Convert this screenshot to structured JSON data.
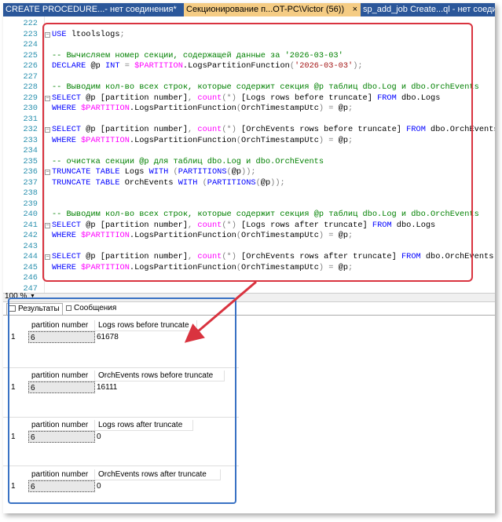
{
  "tabs": [
    {
      "label": "CREATE PROCEDURE...- нет соединения*",
      "active": false
    },
    {
      "label": "Секционирование п...OT-PC\\Victor (56))",
      "active": true
    },
    {
      "label": "sp_add_job Create...ql - нет соединения",
      "active": false
    }
  ],
  "close_glyph": "×",
  "lines": [
    {
      "n": "222",
      "t": ""
    },
    {
      "n": "223",
      "t": "USE ltoolslogs;"
    },
    {
      "n": "224",
      "t": ""
    },
    {
      "n": "225",
      "t": "-- Вычисляем номер секции, содержащей данные за '2026-03-03'"
    },
    {
      "n": "226",
      "t": "DECLARE @p INT = $PARTITION.LogsPartitionFunction('2026-03-03');"
    },
    {
      "n": "227",
      "t": ""
    },
    {
      "n": "228",
      "t": "-- Выводим кол-во всех строк, которые содержит секция @p таблиц dbo.Log и dbo.OrchEvents"
    },
    {
      "n": "229",
      "t": "SELECT @p [partition number], count(*) [Logs rows before truncate] FROM dbo.Logs"
    },
    {
      "n": "230",
      "t": "WHERE $PARTITION.LogsPartitionFunction(OrchTimestampUtc) = @p;"
    },
    {
      "n": "231",
      "t": ""
    },
    {
      "n": "232",
      "t": "SELECT @p [partition number], count(*) [OrchEvents rows before truncate] FROM dbo.OrchEvents"
    },
    {
      "n": "233",
      "t": "WHERE $PARTITION.LogsPartitionFunction(OrchTimestampUtc) = @p;"
    },
    {
      "n": "234",
      "t": ""
    },
    {
      "n": "235",
      "t": "-- очистка секции @p для таблиц dbo.Log и dbo.OrchEvents"
    },
    {
      "n": "236",
      "t": "TRUNCATE TABLE Logs WITH (PARTITIONS(@p));"
    },
    {
      "n": "237",
      "t": "TRUNCATE TABLE OrchEvents WITH (PARTITIONS(@p));"
    },
    {
      "n": "238",
      "t": ""
    },
    {
      "n": "239",
      "t": ""
    },
    {
      "n": "240",
      "t": "-- Выводим кол-во всех строк, которые содержит секция @p таблиц dbo.Log и dbo.OrchEvents"
    },
    {
      "n": "241",
      "t": "SELECT @p [partition number], count(*) [Logs rows after truncate] FROM dbo.Logs"
    },
    {
      "n": "242",
      "t": "WHERE $PARTITION.LogsPartitionFunction(OrchTimestampUtc) = @p;"
    },
    {
      "n": "243",
      "t": ""
    },
    {
      "n": "244",
      "t": "SELECT @p [partition number], count(*) [OrchEvents rows after truncate] FROM dbo.OrchEvents"
    },
    {
      "n": "245",
      "t": "WHERE $PARTITION.LogsPartitionFunction(OrchTimestampUtc) = @p;"
    },
    {
      "n": "246",
      "t": ""
    },
    {
      "n": "247",
      "t": ""
    }
  ],
  "zoom": "100 %",
  "result_tabs": [
    {
      "label": "Результаты",
      "active": true
    },
    {
      "label": "Сообщения",
      "active": false
    }
  ],
  "results": [
    {
      "row": "1",
      "headers": [
        "partition number",
        "Logs rows before truncate"
      ],
      "values": [
        "6",
        "61678"
      ]
    },
    {
      "row": "1",
      "headers": [
        "partition number",
        "OrchEvents rows before truncate"
      ],
      "values": [
        "6",
        "16111"
      ]
    },
    {
      "row": "1",
      "headers": [
        "partition number",
        "Logs rows after truncate"
      ],
      "values": [
        "6",
        "0"
      ]
    },
    {
      "row": "1",
      "headers": [
        "partition number",
        "OrchEvents rows after truncate"
      ],
      "values": [
        "6",
        "0"
      ]
    }
  ],
  "colors": {
    "tabbar": "#2b579a",
    "active_tab": "#f5cc84",
    "red_box": "#d9333f",
    "blue_box": "#3a72c4",
    "keyword": "#0000ff",
    "function": "#ff00ff",
    "string": "#a31515",
    "comment": "#008000"
  }
}
